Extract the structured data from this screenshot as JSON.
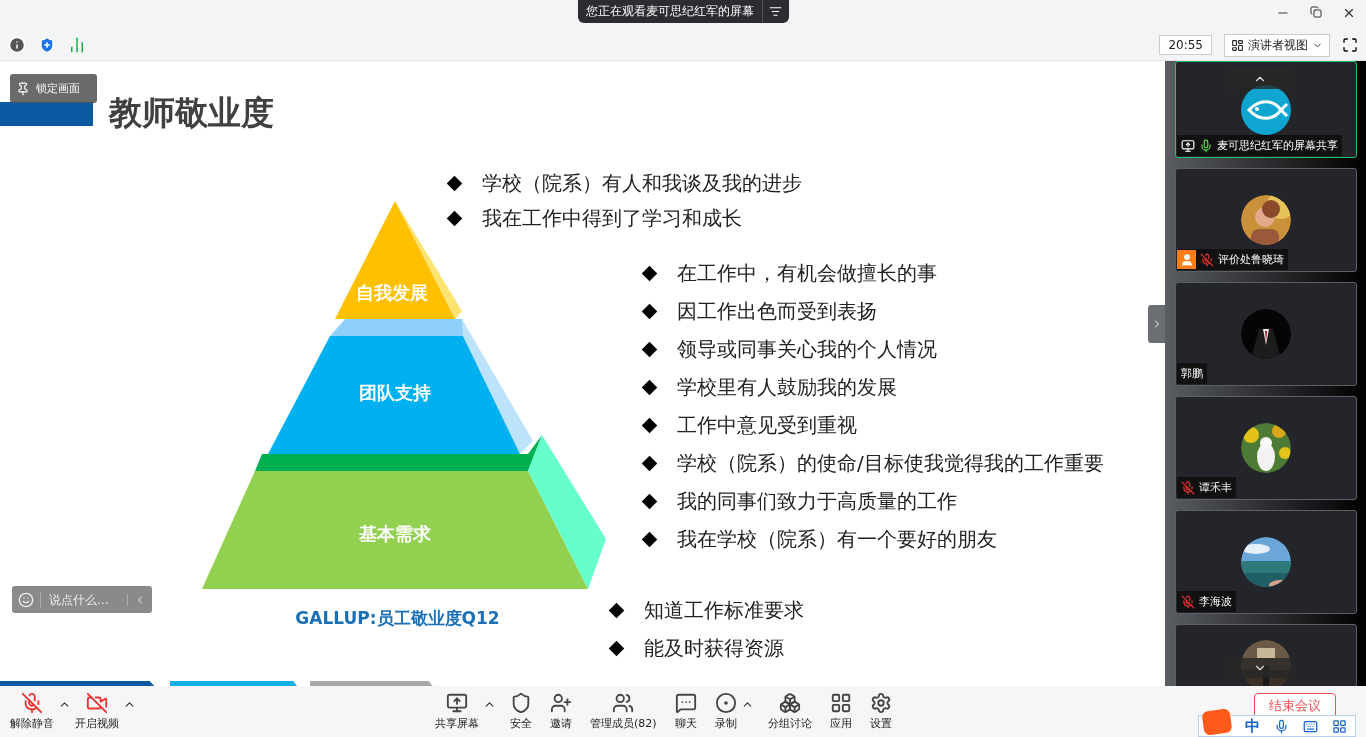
{
  "top_bar": {
    "viewing_notice": "您正在观看麦可思纪红军的屏幕"
  },
  "info_bar": {
    "time": "20:55",
    "view_menu": "演讲者视图"
  },
  "slide": {
    "lock_button": "锁定画面",
    "title": "教师敬业度",
    "pyramid": {
      "tiers": [
        "自我发展",
        "团队支持",
        "基本需求"
      ],
      "caption": "GALLUP:员工敬业度Q12"
    },
    "bullet_groups": [
      {
        "items": [
          "学校（院系）有人和我谈及我的进步",
          "我在工作中得到了学习和成长"
        ]
      },
      {
        "items": [
          "在工作中，有机会做擅长的事",
          "因工作出色而受到表扬",
          "领导或同事关心我的个人情况",
          "学校里有人鼓励我的发展",
          "工作中意见受到重视",
          "学校（院系）的使命/目标使我觉得我的工作重要",
          "我的同事们致力于高质量的工作",
          "我在学校（院系）有一个要好的朋友"
        ]
      },
      {
        "items": [
          "知道工作标准要求",
          "能及时获得资源"
        ]
      }
    ],
    "chat_placeholder": "说点什么..."
  },
  "participants": [
    {
      "name": "麦可思纪红军的屏幕共享",
      "selected": true,
      "muted": false,
      "sharing": true,
      "host": false,
      "avatar": {
        "kind": "logo"
      }
    },
    {
      "name": "评价处鲁晓琦",
      "selected": false,
      "muted": true,
      "sharing": false,
      "host": true
    },
    {
      "name": "郭鹏",
      "selected": false,
      "sharing": false,
      "host": false
    },
    {
      "name": "谭禾丰",
      "selected": false,
      "muted": true,
      "sharing": false,
      "host": false
    },
    {
      "name": "李海波",
      "selected": false,
      "muted": true,
      "sharing": false,
      "host": false
    },
    {
      "selected": false,
      "sharing": false,
      "host": false
    }
  ],
  "toolbar": {
    "left": [
      {
        "label": "解除静音",
        "off": true,
        "caret": true
      },
      {
        "label": "开启视频",
        "off": true,
        "caret": true
      }
    ],
    "center": [
      {
        "label": "共享屏幕",
        "caret": true
      },
      {
        "label": "安全",
        "caret": false
      },
      {
        "label": "邀请",
        "caret": false
      },
      {
        "label": "管理成员(82)",
        "caret": false
      },
      {
        "label": "聊天",
        "caret": false
      },
      {
        "label": "录制",
        "caret": true
      },
      {
        "label": "分组讨论",
        "caret": false
      },
      {
        "label": "应用",
        "caret": false
      },
      {
        "label": "设置",
        "caret": false
      }
    ],
    "end_button": "结束会议"
  },
  "ime_bar": {
    "mode": "中"
  }
}
